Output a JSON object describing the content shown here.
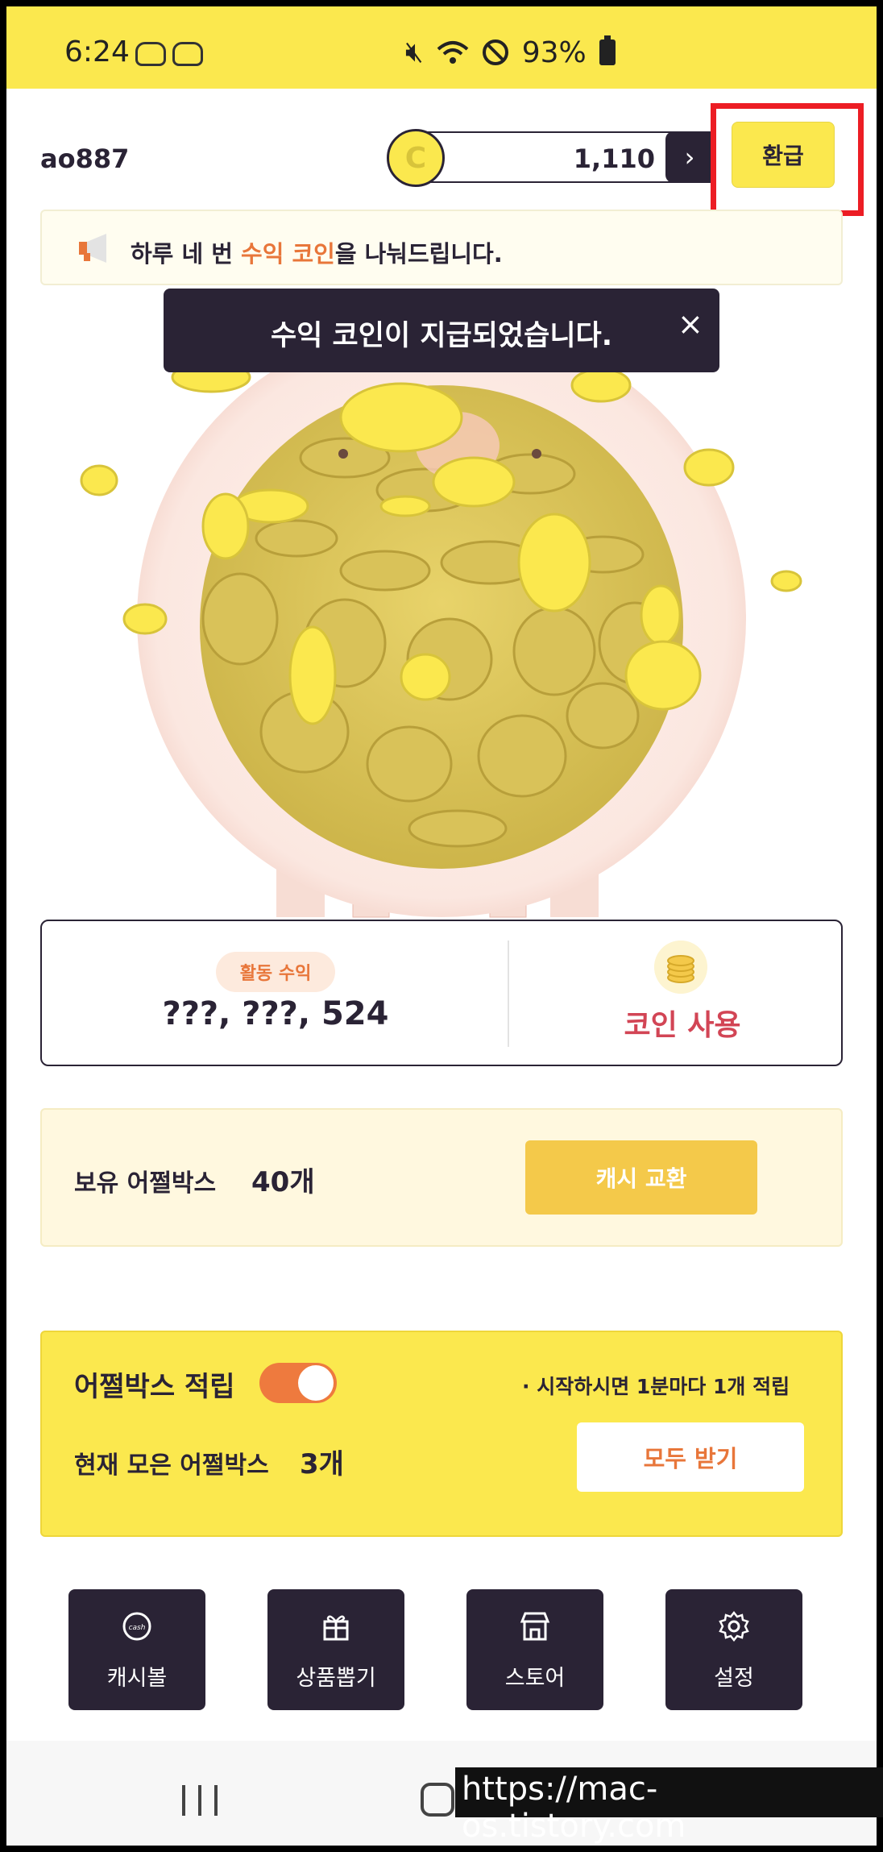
{
  "status_bar": {
    "time": "6:24",
    "battery": "93%"
  },
  "header": {
    "username": "ao887",
    "coin_balance": "1,110",
    "coin_symbol": "C",
    "arrow": "›",
    "refund_label": "환급"
  },
  "notice": {
    "prefix": "하루 네 번 ",
    "highlight": "수익 코인",
    "suffix": "을 나눠드립니다."
  },
  "toast": {
    "message": "수익 코인이 지급되었습니다.",
    "close": "×"
  },
  "earnings": {
    "badge": "활동 수익",
    "value": "???, ???, 524",
    "coin_use_label": "코인 사용"
  },
  "box": {
    "label": "보유 어쩔박스",
    "count": "40개",
    "cash_exchange_label": "캐시 교환"
  },
  "accumulate": {
    "title": "어쩔박스 적립",
    "toggle_on": true,
    "hint": "· 시작하시면 1분마다 1개 적립",
    "collected_label": "현재 모은 어쩔박스",
    "collected_count": "3개",
    "receive_all_label": "모두 받기"
  },
  "bottom_nav": [
    {
      "label": "캐시볼",
      "icon": "cash-ball-icon"
    },
    {
      "label": "상품뽑기",
      "icon": "gift-icon"
    },
    {
      "label": "스토어",
      "icon": "store-icon"
    },
    {
      "label": "설정",
      "icon": "gear-icon"
    }
  ],
  "watermark": "https://mac-os.tistory.com",
  "colors": {
    "accent_yellow": "#fbe84e",
    "dark": "#2a2335",
    "orange": "#e8763a",
    "red_text": "#d24555",
    "highlight_box": "#ec1d24"
  }
}
